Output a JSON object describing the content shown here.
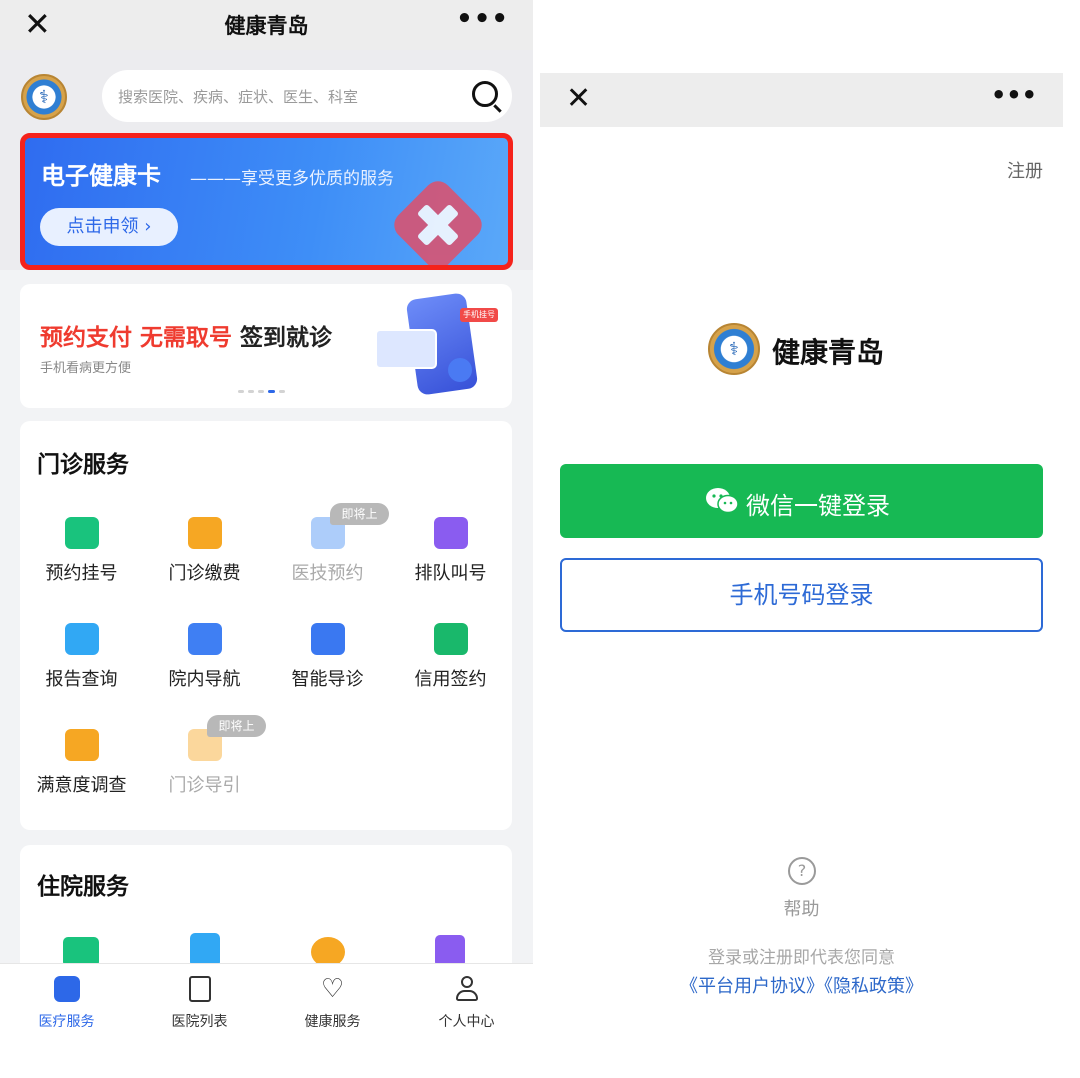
{
  "left": {
    "nav": {
      "close": "✕",
      "title": "健康青岛",
      "more": "•••"
    },
    "search": {
      "placeholder": "搜索医院、疾病、症状、医生、科室"
    },
    "health_card": {
      "title": "电子健康卡",
      "subtitle": "———享受更多优质的服务",
      "button": "点击申领 ›"
    },
    "banner": {
      "red_text": "预约支付 无需取号",
      "black_text": "签到就诊",
      "sub": "手机看病更方便",
      "tag": "手机挂号",
      "card_text": "手机挂号"
    },
    "outpatient": {
      "title": "门诊服务",
      "items": [
        {
          "label": "预约挂号",
          "icon": "calendar-icon",
          "color": "#19c37d"
        },
        {
          "label": "门诊缴费",
          "icon": "wallet-icon",
          "color": "#f6a723"
        },
        {
          "label": "医技预约",
          "icon": "syringe-icon",
          "color": "#4a90f5",
          "badge": "即将上线",
          "disabled": true
        },
        {
          "label": "排队叫号",
          "icon": "headset-user-icon",
          "color": "#8a5cf0"
        },
        {
          "label": "报告查询",
          "icon": "report-icon",
          "color": "#31a8f4"
        },
        {
          "label": "院内导航",
          "icon": "location-icon",
          "color": "#3f7ff3"
        },
        {
          "label": "智能导诊",
          "icon": "robot-icon",
          "color": "#3a78f1"
        },
        {
          "label": "信用签约",
          "icon": "credit-card-icon",
          "color": "#19b86b"
        },
        {
          "label": "满意度调查",
          "icon": "star-survey-icon",
          "color": "#f6a723"
        },
        {
          "label": "门诊导引",
          "icon": "guide-icon",
          "color": "#f6a723",
          "badge": "即将上线",
          "disabled": true
        }
      ]
    },
    "inpatient": {
      "title": "住院服务"
    },
    "tabbar": [
      {
        "label": "医疗服务",
        "icon": "medical-home-icon",
        "active": true
      },
      {
        "label": "医院列表",
        "icon": "hospital-list-icon",
        "active": false
      },
      {
        "label": "健康服务",
        "icon": "heart-pulse-icon",
        "active": false
      },
      {
        "label": "个人中心",
        "icon": "user-icon",
        "active": false
      }
    ]
  },
  "right": {
    "nav": {
      "close": "✕",
      "more": "•••"
    },
    "register": "注册",
    "brand": "健康青岛",
    "wechat_login": "微信一键登录",
    "phone_login": "手机号码登录",
    "help_icon": "?",
    "help": "帮助",
    "agreement_text": "登录或注册即代表您同意",
    "agreement_links": "《平台用户协议》《隐私政策》"
  },
  "colors": {
    "brand_blue": "#2d68e8",
    "wechat_green": "#17b954",
    "highlight_red": "#f5221b"
  }
}
